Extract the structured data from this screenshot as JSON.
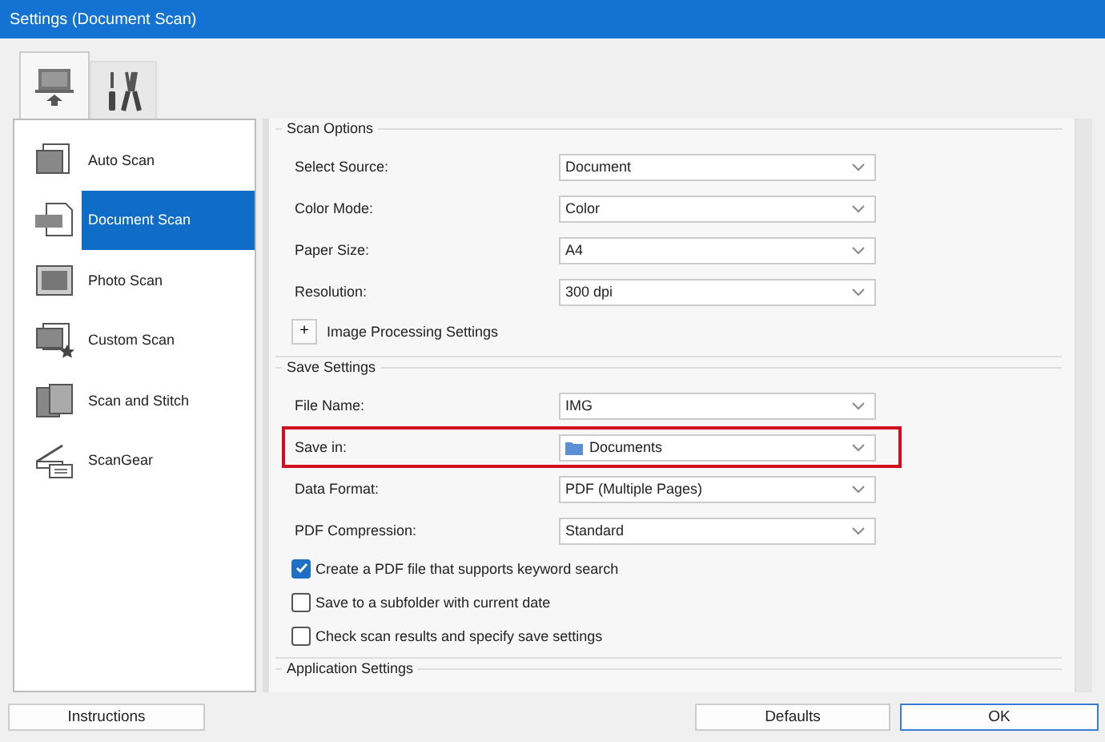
{
  "window": {
    "title": "Settings (Document Scan)"
  },
  "tabs": [
    {
      "selected": true
    },
    {
      "selected": false
    }
  ],
  "sidebar": {
    "items": [
      {
        "label": "Auto Scan",
        "selected": false
      },
      {
        "label": "Document Scan",
        "selected": true
      },
      {
        "label": "Photo Scan",
        "selected": false
      },
      {
        "label": "Custom Scan",
        "selected": false
      },
      {
        "label": "Scan and Stitch",
        "selected": false
      },
      {
        "label": "ScanGear",
        "selected": false
      }
    ]
  },
  "scan_options": {
    "title": "Scan Options",
    "fields": [
      {
        "label": "Select Source:",
        "value": "Document",
        "kind": "select",
        "highlighted": false
      },
      {
        "label": "Color Mode:",
        "value": "Color",
        "kind": "select",
        "highlighted": false
      },
      {
        "label": "Paper Size:",
        "value": "A4",
        "kind": "select",
        "highlighted": false
      },
      {
        "label": "Resolution:",
        "value": "300 dpi",
        "kind": "select",
        "highlighted": false
      }
    ],
    "expander": {
      "symbol": "+",
      "label": "Image Processing Settings"
    }
  },
  "save_settings": {
    "title": "Save Settings",
    "fields": [
      {
        "label": "File Name:",
        "value": "IMG",
        "kind": "select",
        "highlighted": false
      },
      {
        "label": "Save in:",
        "value": "Documents",
        "kind": "folder",
        "highlighted": true
      },
      {
        "label": "Data Format:",
        "value": "PDF (Multiple Pages)",
        "kind": "select",
        "highlighted": false
      },
      {
        "label": "PDF Compression:",
        "value": "Standard",
        "kind": "select",
        "highlighted": false
      }
    ],
    "checkboxes": [
      {
        "label": "Create a PDF file that supports keyword search",
        "checked": true
      },
      {
        "label": "Save to a subfolder with current date",
        "checked": false
      },
      {
        "label": "Check scan results and specify save settings",
        "checked": false
      }
    ]
  },
  "application_settings": {
    "title": "Application Settings"
  },
  "buttons": [
    {
      "label": "Instructions",
      "kind": "left"
    },
    {
      "label": "Defaults",
      "kind": "right"
    },
    {
      "label": "OK",
      "kind": "default"
    }
  ]
}
